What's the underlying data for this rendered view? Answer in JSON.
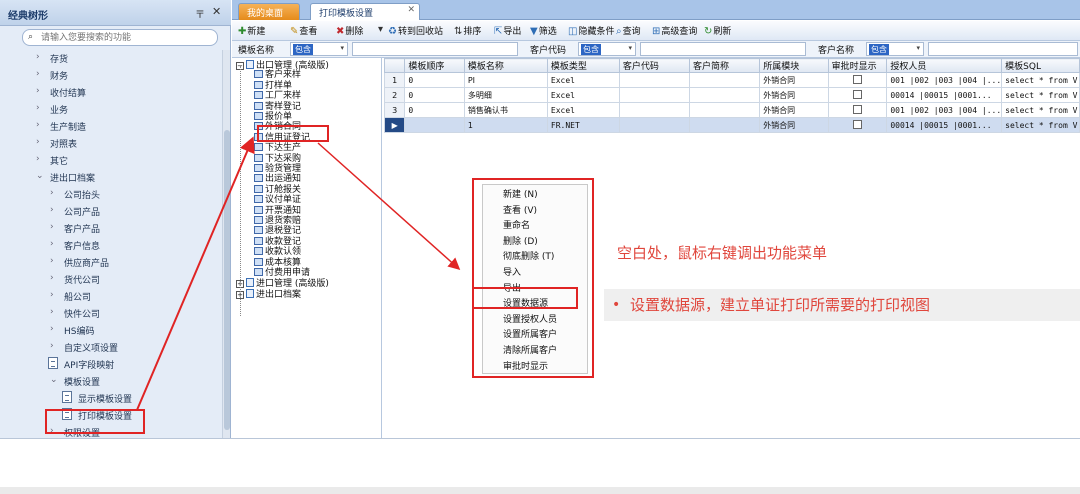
{
  "nav": {
    "title": "经典树形",
    "pin": "〒",
    "close": "✕",
    "search_placeholder": "请输入您要搜索的功能",
    "items": [
      {
        "label": "存货",
        "chev": "›"
      },
      {
        "label": "财务",
        "chev": "›"
      },
      {
        "label": "收付结算",
        "chev": "›"
      },
      {
        "label": "业务",
        "chev": "›"
      },
      {
        "label": "生产制造",
        "chev": "›"
      },
      {
        "label": "对照表",
        "chev": "›"
      },
      {
        "label": "其它",
        "chev": "›"
      },
      {
        "label": "进出口档案",
        "chev": "⌄"
      },
      {
        "label": "公司抬头",
        "chev": "›"
      },
      {
        "label": "公司产品",
        "chev": "›"
      },
      {
        "label": "客户产品",
        "chev": "›"
      },
      {
        "label": "客户信息",
        "chev": "›"
      },
      {
        "label": "供应商产品",
        "chev": "›"
      },
      {
        "label": "货代公司",
        "chev": "›"
      },
      {
        "label": "船公司",
        "chev": "›"
      },
      {
        "label": "快件公司",
        "chev": "›"
      },
      {
        "label": "HS编码",
        "chev": "›"
      },
      {
        "label": "自定义项设置",
        "chev": "›"
      },
      {
        "label": "API字段映射",
        "chev": ""
      },
      {
        "label": "模板设置",
        "chev": "⌄"
      },
      {
        "label": "显示模板设置",
        "chev": ""
      },
      {
        "label": "打印模板设置",
        "chev": ""
      },
      {
        "label": "权限设置",
        "chev": "›"
      }
    ]
  },
  "tabs": {
    "desktop": "我的桌面",
    "print": "打印模板设置",
    "close": "✕"
  },
  "toolbar": [
    {
      "icon": "✚",
      "label": "新建"
    },
    {
      "icon": "✎",
      "label": "查看"
    },
    {
      "icon": "✖",
      "label": "删除"
    },
    {
      "icon": "▾",
      "label": ""
    },
    {
      "icon": "♻",
      "label": "转到回收站"
    },
    {
      "icon": "⇅",
      "label": "排序"
    },
    {
      "icon": "⇱",
      "label": "导出"
    },
    {
      "icon": "▼",
      "label": "筛选"
    },
    {
      "icon": "◫",
      "label": "隐藏条件"
    },
    {
      "icon": "⌕",
      "label": "查询"
    },
    {
      "icon": "⊞",
      "label": "高级查询"
    },
    {
      "icon": "↻",
      "label": "刷新"
    }
  ],
  "filter": {
    "template_name_label": "模板名称",
    "customer_code_label": "客户代码",
    "customer_name_label": "客户名称",
    "op": "包含",
    "dropdown": "▾"
  },
  "tree": {
    "nodes": [
      {
        "label": "出口管理 (高级版)",
        "pm": "−",
        "leaf": false
      },
      {
        "label": "客户来样",
        "leaf": true
      },
      {
        "label": "打样单",
        "leaf": true
      },
      {
        "label": "工厂来样",
        "leaf": true
      },
      {
        "label": "寄样登记",
        "leaf": true
      },
      {
        "label": "报价单",
        "leaf": true
      },
      {
        "label": "外销合同",
        "leaf": true
      },
      {
        "label": "信用证登记",
        "leaf": true
      },
      {
        "label": "下达生产",
        "leaf": true
      },
      {
        "label": "下达采购",
        "leaf": true
      },
      {
        "label": "验货管理",
        "leaf": true
      },
      {
        "label": "出运通知",
        "leaf": true
      },
      {
        "label": "订舱报关",
        "leaf": true
      },
      {
        "label": "议付单证",
        "leaf": true
      },
      {
        "label": "开票通知",
        "leaf": true
      },
      {
        "label": "退货索赔",
        "leaf": true
      },
      {
        "label": "退税登记",
        "leaf": true
      },
      {
        "label": "收款登记",
        "leaf": true
      },
      {
        "label": "收款认领",
        "leaf": true
      },
      {
        "label": "成本核算",
        "leaf": true
      },
      {
        "label": "付费用申请",
        "leaf": true
      },
      {
        "label": "进口管理 (高级版)",
        "pm": "+",
        "leaf": false
      },
      {
        "label": "进出口档案",
        "pm": "+",
        "leaf": false
      }
    ]
  },
  "grid": {
    "columns": [
      "",
      "模板顺序",
      "模板名称",
      "模板类型",
      "客户代码",
      "客户简称",
      "所属模块",
      "审批时显示",
      "授权人员",
      "模板SQL"
    ],
    "rows": [
      {
        "rn": "1",
        "cells": [
          "0",
          "PI",
          "Excel",
          "",
          "",
          "外销合同",
          "",
          "001 |002 |003 |004 |...",
          "select * from V"
        ]
      },
      {
        "rn": "2",
        "cells": [
          "0",
          "多明细",
          "Excel",
          "",
          "",
          "外销合同",
          "",
          "00014 |00015 |0001...",
          "select * from V"
        ]
      },
      {
        "rn": "3",
        "cells": [
          "0",
          "销售确认书",
          "Excel",
          "",
          "",
          "外销合同",
          "",
          "001 |002 |003 |004 |...",
          "select * from V"
        ]
      },
      {
        "rn": "▶",
        "cells": [
          "",
          "1",
          "FR.NET",
          "",
          "",
          "外销合同",
          "",
          "00014 |00015 |0001...",
          "select * from V"
        ]
      }
    ]
  },
  "context_menu": [
    "新建 (N)",
    "查看 (V)",
    "重命名",
    "删除 (D)",
    "彻底删除 (T)",
    "导入",
    "导出",
    "设置数据源",
    "设置授权人员",
    "设置所属客户",
    "清除所属客户",
    "审批时显示"
  ],
  "annotations": {
    "blank_right_click": "空白处，鼠标右键调出功能菜单",
    "bullet": "•",
    "set_data_source": "设置数据源，建立单证打印所需要的打印视图"
  },
  "colors": {
    "highlight_red": "#e02424",
    "annotation_red": "#e0463c",
    "tab_orange": "#e58b1b",
    "nav_bg": "#e4ecf7"
  }
}
